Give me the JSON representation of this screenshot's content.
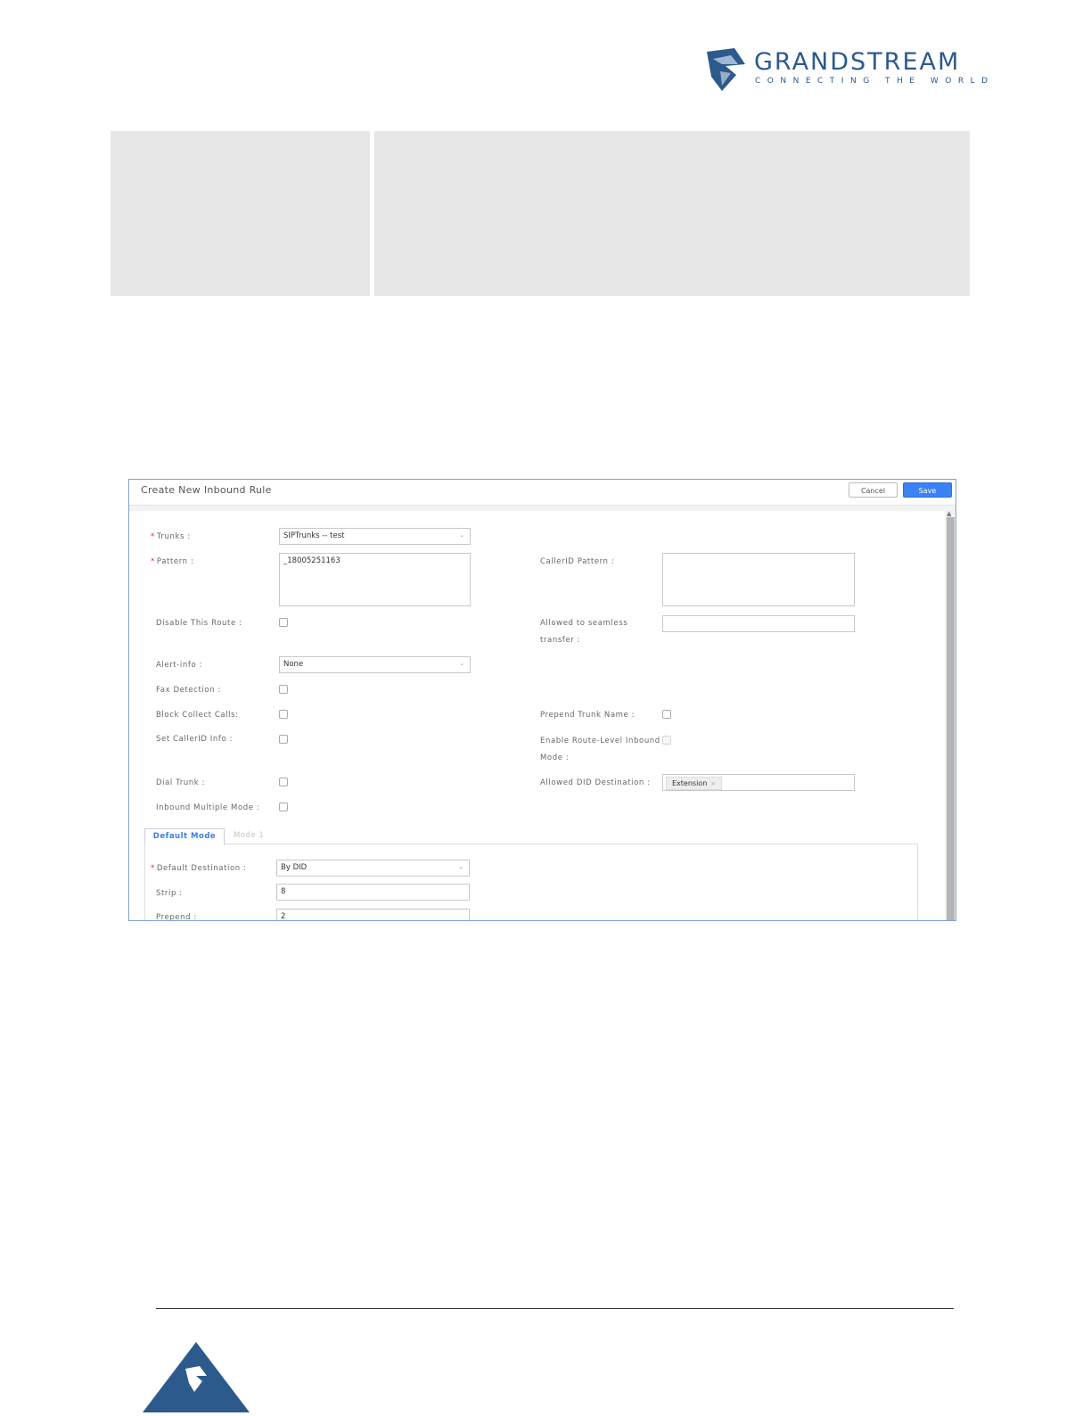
{
  "logo": {
    "brand": "GRANDSTREAM",
    "tagline": "CONNECTING THE WORLD"
  },
  "dialog": {
    "title": "Create New Inbound Rule",
    "cancel_label": "Cancel",
    "save_label": "Save",
    "fields": {
      "trunks_label": "Trunks :",
      "trunks_value": "SIPTrunks -- test",
      "pattern_label": "Pattern :",
      "pattern_value": "_18005251163",
      "callerid_pattern_label": "CallerID Pattern :",
      "callerid_pattern_value": "",
      "disable_route_label": "Disable This Route :",
      "seamless_transfer_label_1": "Allowed to seamless",
      "seamless_transfer_label_2": "transfer :",
      "seamless_transfer_value": "",
      "alert_info_label": "Alert-info :",
      "alert_info_value": "None",
      "fax_detection_label": "Fax Detection :",
      "block_collect_label": "Block Collect Calls:",
      "prepend_trunk_label": "Prepend Trunk Name :",
      "set_callerid_label": "Set CallerID Info :",
      "route_level_label_1": "Enable Route-Level Inbound",
      "route_level_label_2": "Mode :",
      "dial_trunk_label": "Dial Trunk :",
      "allowed_did_label": "Allowed DID Destination :",
      "allowed_did_tag": "Extension",
      "inbound_multiple_label": "Inbound Multiple Mode :"
    },
    "tabs": [
      "Default Mode",
      "Mode 1"
    ],
    "mode": {
      "default_destination_label": "Default Destination :",
      "default_destination_value": "By DID",
      "strip_label": "Strip :",
      "strip_value": "8",
      "prepend_label": "Prepend :",
      "prepend_value": "2"
    }
  },
  "colors": {
    "brand": "#2d5a8c",
    "accent": "#3b82f6",
    "table_fill": "#e7e7e7"
  }
}
